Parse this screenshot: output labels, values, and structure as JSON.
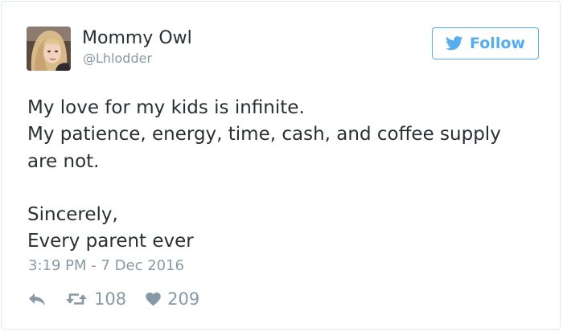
{
  "user": {
    "display_name": "Mommy Owl",
    "handle": "@Lhlodder"
  },
  "follow_button": {
    "label": "Follow",
    "icon": "twitter-bird-icon",
    "color": "#55acee"
  },
  "tweet": {
    "lines": [
      "My love for my kids is infinite.",
      "My patience, energy, time, cash, and coffee supply",
      "are not.",
      "",
      "Sincerely,",
      "Every parent ever"
    ],
    "timestamp": "3:19 PM - 7 Dec 2016"
  },
  "actions": {
    "reply_icon": "reply-icon",
    "retweet_icon": "retweet-icon",
    "retweet_count": "108",
    "like_icon": "heart-icon",
    "like_count": "209"
  },
  "colors": {
    "text": "#292f33",
    "muted": "#8899a6",
    "border": "#e1e8ed",
    "accent": "#55acee"
  }
}
